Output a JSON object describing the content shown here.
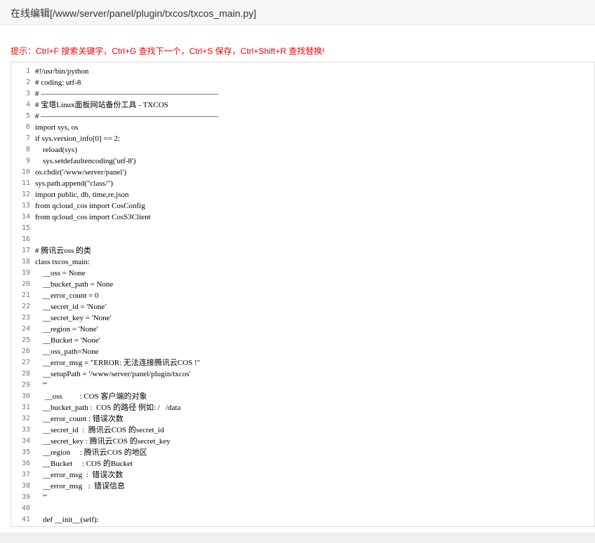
{
  "window": {
    "title": "在线编辑[/www/server/panel/plugin/txcos/txcos_main.py]"
  },
  "hint": "提示：Ctrl+F 搜索关键字，Ctrl+G 查找下一个，Ctrl+S 保存，Ctrl+Shift+R 查找替换!",
  "editor": {
    "lines": [
      {
        "n": "1",
        "t": "#!/usr/bin/python"
      },
      {
        "n": "2",
        "t": "# coding: utf-8"
      },
      {
        "n": "3",
        "t": "# ———————————————————————"
      },
      {
        "n": "4",
        "t": "# 宝塔Linux面板网站备份工具 - TXCOS"
      },
      {
        "n": "5",
        "t": "# ———————————————————————"
      },
      {
        "n": "6",
        "t": "import sys, os"
      },
      {
        "n": "7",
        "t": "if sys.version_info[0] == 2:"
      },
      {
        "n": "8",
        "t": "    reload(sys)"
      },
      {
        "n": "9",
        "t": "    sys.setdefaultencoding('utf-8')"
      },
      {
        "n": "10",
        "t": "os.chdir('/www/server/panel')"
      },
      {
        "n": "11",
        "t": "sys.path.append(\"class/\")"
      },
      {
        "n": "12",
        "t": "import public, db, time,re,json"
      },
      {
        "n": "13",
        "t": "from qcloud_cos import CosConfig"
      },
      {
        "n": "14",
        "t": "from qcloud_cos import CosS3Client"
      },
      {
        "n": "15",
        "t": ""
      },
      {
        "n": "16",
        "t": ""
      },
      {
        "n": "17",
        "t": "# 腾讯云oss 的类"
      },
      {
        "n": "18",
        "t": "class txcos_main:"
      },
      {
        "n": "19",
        "t": "    __oss = None"
      },
      {
        "n": "20",
        "t": "    __bucket_path = None"
      },
      {
        "n": "21",
        "t": "    __error_count = 0"
      },
      {
        "n": "22",
        "t": "    __secret_id = 'None'"
      },
      {
        "n": "23",
        "t": "    __secret_key = 'None'"
      },
      {
        "n": "24",
        "t": "    __region = 'None'"
      },
      {
        "n": "25",
        "t": "    __Bucket = 'None'"
      },
      {
        "n": "26",
        "t": "    __oss_path=None"
      },
      {
        "n": "27",
        "t": "    __error_msg = \"ERROR: 无法连接腾讯云COS !\""
      },
      {
        "n": "28",
        "t": "    __setupPath = '/www/server/panel/plugin/txcos'"
      },
      {
        "n": "29",
        "t": "    '''"
      },
      {
        "n": "30",
        "t": "     __oss         : COS 客户端的对象"
      },
      {
        "n": "31",
        "t": "    __bucket_path :  COS 的路径 例如: /   /data"
      },
      {
        "n": "32",
        "t": "    __error_count : 错误次数"
      },
      {
        "n": "33",
        "t": "    __secret_id  :  腾讯云COS 的secret_id"
      },
      {
        "n": "34",
        "t": "    __secret_key : 腾讯云COS 的secret_key"
      },
      {
        "n": "35",
        "t": "    __region     : 腾讯云COS 的地区"
      },
      {
        "n": "36",
        "t": "    __Bucket     : COS 的Bucket"
      },
      {
        "n": "37",
        "t": "    __error_msg  :  错误次数"
      },
      {
        "n": "38",
        "t": "    __error_msg   :  错误信息"
      },
      {
        "n": "39",
        "t": "    '''"
      },
      {
        "n": "40",
        "t": ""
      },
      {
        "n": "41",
        "t": "    def __init__(self):"
      }
    ]
  }
}
